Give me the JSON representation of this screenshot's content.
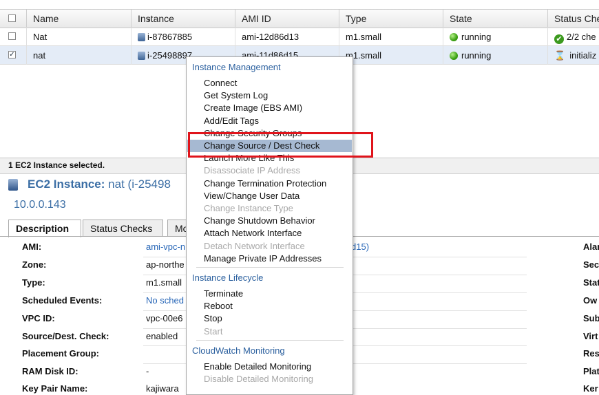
{
  "table": {
    "headers": [
      "Name",
      "Instance",
      "AMI ID",
      "Type",
      "State",
      "Status Che"
    ],
    "rows": [
      {
        "checked": false,
        "name": "Nat",
        "instance": "i-87867885",
        "ami": "ami-12d86d13",
        "type": "m1.small",
        "state": "running",
        "status": "2/2 che"
      },
      {
        "checked": true,
        "name": "nat",
        "instance": "i-25498897",
        "ami": "ami-11d86d15",
        "type": "m1.small",
        "state": "running",
        "status": "initializ"
      }
    ]
  },
  "selection_bar": "1 EC2 Instance selected.",
  "detail": {
    "title_label": "EC2 Instance:",
    "title_name": "nat (i-25498",
    "ip": "10.0.0.143",
    "tabs": [
      "Description",
      "Status Checks",
      "Mo"
    ],
    "fields": [
      {
        "label": "AMI:",
        "value": "ami-vpc-n",
        "link": true
      },
      {
        "label": "Zone:",
        "value": "ap-northe",
        "link": false
      },
      {
        "label": "Type:",
        "value": "m1.small",
        "link": false
      },
      {
        "label": "Scheduled Events:",
        "value": "No sched",
        "link": true
      },
      {
        "label": "VPC ID:",
        "value": "vpc-00e6",
        "link": false
      },
      {
        "label": "Source/Dest. Check:",
        "value": "enabled",
        "link": false
      },
      {
        "label": "Placement Group:",
        "value": "",
        "link": false
      },
      {
        "label": "RAM Disk ID:",
        "value": "-",
        "link": false
      },
      {
        "label": "Key Pair Name:",
        "value": "kajiwara",
        "link": false
      }
    ],
    "ami_suffix": "d15)",
    "right_labels": [
      "Alar",
      "Sec",
      "Stat",
      "Ow",
      "Sub",
      "Virt",
      "Res",
      "Plat",
      "Ker"
    ]
  },
  "menu": {
    "sections": [
      {
        "header": "Instance Management",
        "items": [
          {
            "label": "Connect",
            "disabled": false
          },
          {
            "label": "Get System Log",
            "disabled": false
          },
          {
            "label": "Create Image (EBS AMI)",
            "disabled": false
          },
          {
            "label": "Add/Edit Tags",
            "disabled": false
          },
          {
            "label": "Change Security Groups",
            "disabled": false
          },
          {
            "label": "Change Source / Dest Check",
            "disabled": false,
            "highlighted": true
          },
          {
            "label": "Launch More Like This",
            "disabled": false
          },
          {
            "label": "Disassociate IP Address",
            "disabled": true
          },
          {
            "label": "Change Termination Protection",
            "disabled": false
          },
          {
            "label": "View/Change User Data",
            "disabled": false
          },
          {
            "label": "Change Instance Type",
            "disabled": true
          },
          {
            "label": "Change Shutdown Behavior",
            "disabled": false
          },
          {
            "label": "Attach Network Interface",
            "disabled": false
          },
          {
            "label": "Detach Network Interface",
            "disabled": true
          },
          {
            "label": "Manage Private IP Addresses",
            "disabled": false
          }
        ]
      },
      {
        "header": "Instance Lifecycle",
        "items": [
          {
            "label": "Terminate",
            "disabled": false
          },
          {
            "label": "Reboot",
            "disabled": false
          },
          {
            "label": "Stop",
            "disabled": false
          },
          {
            "label": "Start",
            "disabled": true
          }
        ]
      },
      {
        "header": "CloudWatch Monitoring",
        "items": [
          {
            "label": "Enable Detailed Monitoring",
            "disabled": false
          },
          {
            "label": "Disable Detailed Monitoring",
            "disabled": true
          }
        ]
      }
    ]
  },
  "colors": {
    "accent": "#2a5f9e",
    "highlight": "#a6b9d2",
    "callout": "#e0141b",
    "running": "#3aa011"
  }
}
